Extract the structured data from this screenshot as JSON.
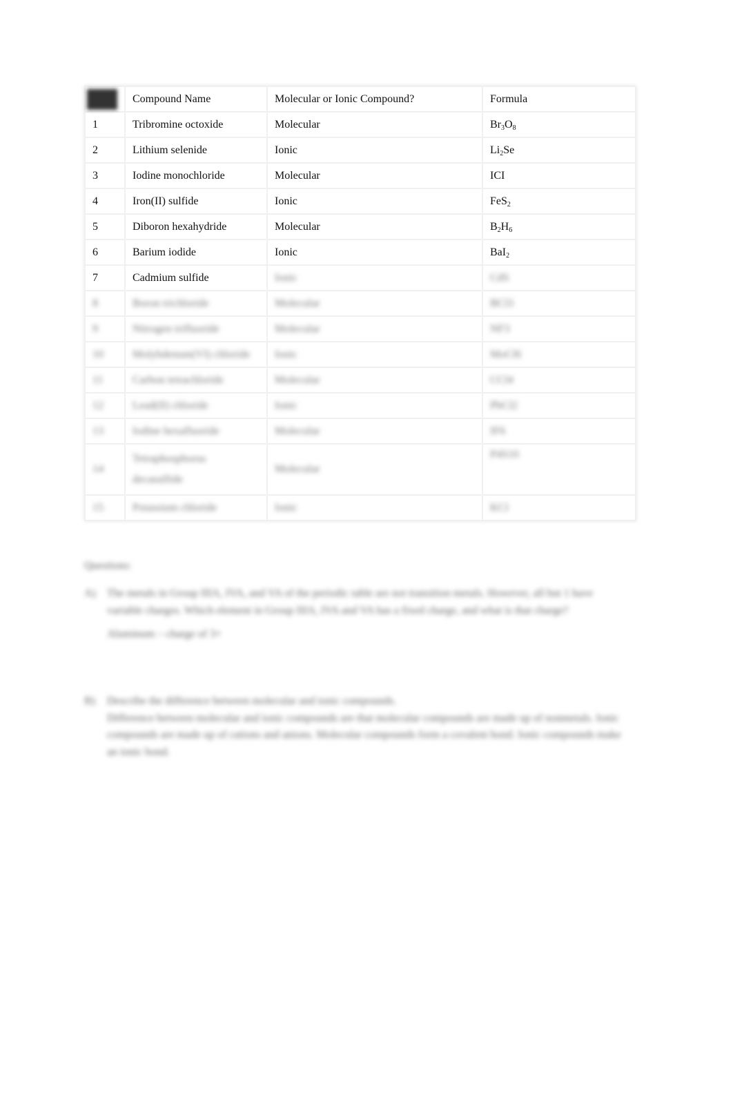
{
  "table": {
    "headers": [
      "",
      "Compound Name",
      "Molecular or Ionic Compound?",
      "Formula"
    ],
    "rows": [
      {
        "num": "1",
        "name": "Tribromine octoxide",
        "type": "Molecular",
        "formula": [
          [
            "Br",
            ""
          ],
          [
            "3",
            "sub"
          ],
          [
            "O",
            ""
          ],
          [
            "8",
            "sub"
          ]
        ]
      },
      {
        "num": "2",
        "name": "Lithium selenide",
        "type": "Ionic",
        "formula": [
          [
            "Li",
            ""
          ],
          [
            "2",
            "sub"
          ],
          [
            "Se",
            ""
          ]
        ]
      },
      {
        "num": "3",
        "name": "Iodine monochloride",
        "type": "Molecular",
        "formula": [
          [
            "ICI",
            ""
          ]
        ]
      },
      {
        "num": "4",
        "name": "Iron(II) sulfide",
        "type": "Ionic",
        "formula": [
          [
            "FeS",
            ""
          ],
          [
            "2",
            "sub"
          ]
        ]
      },
      {
        "num": "5",
        "name": "Diboron hexahydride",
        "type": "Molecular",
        "formula": [
          [
            "B",
            ""
          ],
          [
            "2",
            "sub"
          ],
          [
            "H",
            ""
          ],
          [
            "6",
            "sub"
          ]
        ]
      },
      {
        "num": "6",
        "name": "Barium iodide",
        "type": "Ionic",
        "formula": [
          [
            "BaI",
            ""
          ],
          [
            "2",
            "sub"
          ]
        ]
      },
      {
        "num": "7",
        "name": "Cadmium sulfide",
        "type": "Ionic",
        "formula": [
          [
            "CdS",
            ""
          ]
        ],
        "blur_from": "type"
      },
      {
        "num": "8",
        "name": "Boron trichloride",
        "type": "Molecular",
        "formula": [
          [
            "BCl3",
            ""
          ]
        ],
        "blurred": true
      },
      {
        "num": "9",
        "name": "Nitrogen trifluoride",
        "type": "Molecular",
        "formula": [
          [
            "NF3",
            ""
          ]
        ],
        "blurred": true
      },
      {
        "num": "10",
        "name": "Molybdenum(VI) chloride",
        "type": "Ionic",
        "formula": [
          [
            "MoCl6",
            ""
          ]
        ],
        "blurred": true
      },
      {
        "num": "11",
        "name": "Carbon tetrachloride",
        "type": "Molecular",
        "formula": [
          [
            "CCl4",
            ""
          ]
        ],
        "blurred": true
      },
      {
        "num": "12",
        "name": "Lead(II) chloride",
        "type": "Ionic",
        "formula": [
          [
            "PbCl2",
            ""
          ]
        ],
        "blurred": true
      },
      {
        "num": "13",
        "name": "Iodine hexafluoride",
        "type": "Molecular",
        "formula": [
          [
            "IF6",
            ""
          ]
        ],
        "blurred": true
      },
      {
        "num": "14",
        "name": "Tetraphosphorus decasulfide",
        "type": "Molecular",
        "formula": [
          [
            "P4S10",
            ""
          ]
        ],
        "blurred": true,
        "tall": true
      },
      {
        "num": "15",
        "name": "Potassium chloride",
        "type": "Ionic",
        "formula": [
          [
            "KCl",
            ""
          ]
        ],
        "blurred": true
      }
    ]
  },
  "questions": {
    "heading": "Questions:",
    "a": {
      "label": "A)",
      "text": "The metals in Group IIIA, IVA, and VA of the periodic table are not transition metals. However, all but 1 have variable charges. Which element in Group IIIA, IVA and VA has a fixed charge, and what is that charge?",
      "answer": "Aluminum – charge of 3+"
    },
    "b": {
      "label": "B)",
      "text": "Describe the difference between molecular and ionic compounds.",
      "answer": "Difference between molecular and ionic compounds are that molecular compounds are made up of nonmetals. Ionic compounds are made up of cations and anions. Molecular compounds form a covalent bond. Ionic compounds make an ionic bond."
    }
  }
}
